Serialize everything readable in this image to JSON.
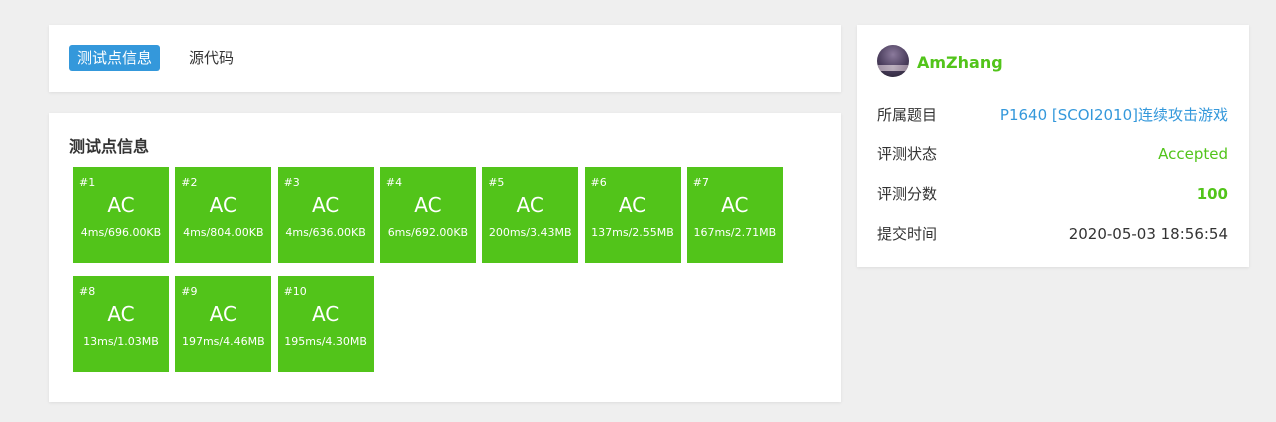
{
  "tabs": {
    "active": "测试点信息",
    "inactive": "源代码"
  },
  "tests": {
    "title": "测试点信息",
    "cases": [
      {
        "id": "#1",
        "status": "AC",
        "stat": "4ms/696.00KB"
      },
      {
        "id": "#2",
        "status": "AC",
        "stat": "4ms/804.00KB"
      },
      {
        "id": "#3",
        "status": "AC",
        "stat": "4ms/636.00KB"
      },
      {
        "id": "#4",
        "status": "AC",
        "stat": "6ms/692.00KB"
      },
      {
        "id": "#5",
        "status": "AC",
        "stat": "200ms/3.43MB"
      },
      {
        "id": "#6",
        "status": "AC",
        "stat": "137ms/2.55MB"
      },
      {
        "id": "#7",
        "status": "AC",
        "stat": "167ms/2.71MB"
      },
      {
        "id": "#8",
        "status": "AC",
        "stat": "13ms/1.03MB"
      },
      {
        "id": "#9",
        "status": "AC",
        "stat": "197ms/4.46MB"
      },
      {
        "id": "#10",
        "status": "AC",
        "stat": "195ms/4.30MB"
      }
    ],
    "color": "#52c41a"
  },
  "info": {
    "username": "AmZhang",
    "problem_label": "所属题目",
    "problem_value": "P1640 [SCOI2010]连续攻击游戏",
    "status_label": "评测状态",
    "status_value": "Accepted",
    "score_label": "评测分数",
    "score_value": "100",
    "time_label": "提交时间",
    "time_value": "2020-05-03 18:56:54"
  },
  "colors": {
    "accent": "#3498db",
    "success": "#52c41a",
    "background": "#efefef"
  }
}
